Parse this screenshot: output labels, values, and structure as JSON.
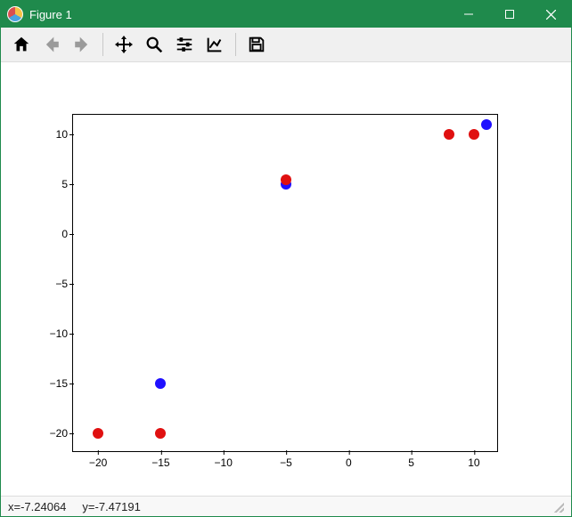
{
  "window": {
    "title": "Figure 1"
  },
  "toolbar": {
    "icons": [
      "home",
      "back",
      "forward",
      "|",
      "move",
      "zoom",
      "sliders",
      "axes",
      "|",
      "save"
    ]
  },
  "status": {
    "x_label": "x=-7.24064",
    "y_label": "y=-7.47191"
  },
  "chart_data": {
    "type": "scatter",
    "xlim": [
      -22,
      12
    ],
    "ylim": [
      -22,
      12
    ],
    "xticks": [
      -20,
      -15,
      -10,
      -5,
      0,
      5,
      10
    ],
    "yticks": [
      -20,
      -15,
      -10,
      -5,
      0,
      5,
      10
    ],
    "series": [
      {
        "name": "blue",
        "color": "#1f10ff",
        "points": [
          {
            "x": -15,
            "y": -15
          },
          {
            "x": -5,
            "y": 5
          },
          {
            "x": 11,
            "y": 11
          }
        ]
      },
      {
        "name": "red",
        "color": "#e01010",
        "points": [
          {
            "x": -20,
            "y": -20
          },
          {
            "x": -15,
            "y": -20
          },
          {
            "x": -5,
            "y": 5.5
          },
          {
            "x": 8,
            "y": 10
          },
          {
            "x": 10,
            "y": 10
          }
        ]
      }
    ]
  }
}
